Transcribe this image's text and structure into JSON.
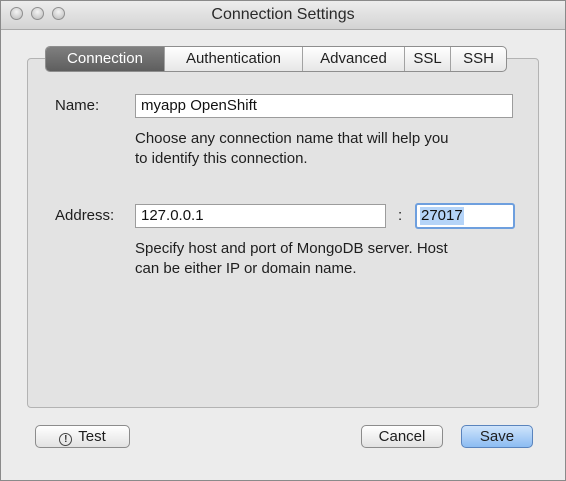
{
  "window": {
    "title": "Connection Settings"
  },
  "tabs": [
    {
      "label": "Connection",
      "active": true
    },
    {
      "label": "Authentication",
      "active": false
    },
    {
      "label": "Advanced",
      "active": false
    },
    {
      "label": "SSL",
      "active": false
    },
    {
      "label": "SSH",
      "active": false
    }
  ],
  "connection": {
    "name_label": "Name:",
    "name_value": "myapp OpenShift",
    "name_help_line1": "Choose any connection name that will help you",
    "name_help_line2": "to identify this connection.",
    "address_label": "Address:",
    "host_value": "127.0.0.1",
    "port_separator": ":",
    "port_value": "27017",
    "address_help_line1": "Specify host and port of MongoDB server. Host",
    "address_help_line2": "can be either IP or domain name."
  },
  "footer": {
    "test_label": "Test",
    "cancel_label": "Cancel",
    "save_label": "Save"
  },
  "colors": {
    "active_tab": "#6b6b6b",
    "focus_ring": "#6e9fde",
    "selection": "#b5d4f8"
  },
  "icons": {
    "test_icon": "info-icon"
  }
}
